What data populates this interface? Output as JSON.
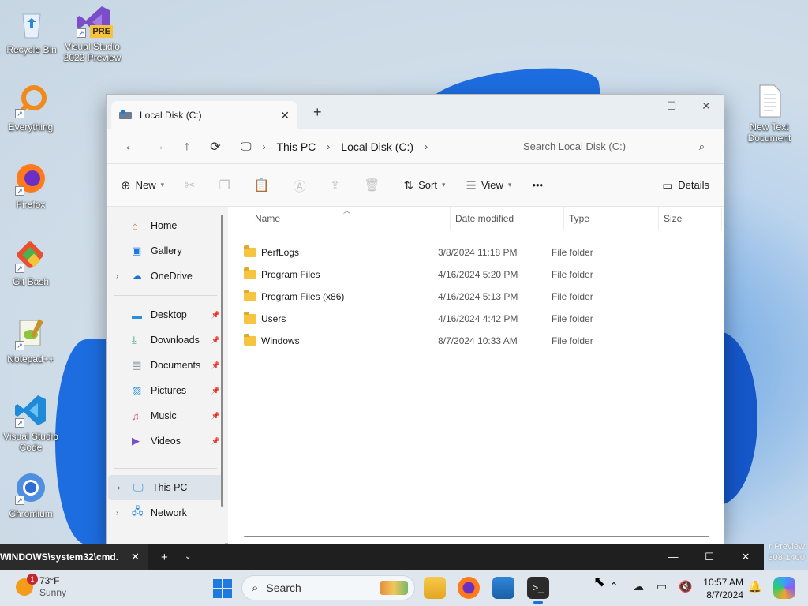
{
  "desktop": {
    "icons": [
      {
        "label": "Recycle Bin",
        "icon": "recycle-bin-icon"
      },
      {
        "label": "Visual Studio 2022 Preview",
        "icon": "visual-studio-icon",
        "badge": "PRE"
      },
      {
        "label": "Everything",
        "icon": "everything-search-icon"
      },
      {
        "label": "Firefox",
        "icon": "firefox-icon"
      },
      {
        "label": "Git Bash",
        "icon": "git-bash-icon"
      },
      {
        "label": "Notepad++",
        "icon": "notepad-plus-plus-icon"
      },
      {
        "label": "Visual Studio Code",
        "icon": "vscode-icon"
      },
      {
        "label": "Chromium",
        "icon": "chromium-icon"
      },
      {
        "label": "New Text Document",
        "icon": "text-document-icon"
      }
    ],
    "watermark_line1": "r Preview",
    "watermark_line2": "308-1400"
  },
  "explorer": {
    "tab_title": "Local Disk (C:)",
    "new_tab": "+",
    "breadcrumb": [
      "This PC",
      "Local Disk (C:)"
    ],
    "search_placeholder": "Search Local Disk (C:)",
    "toolbar": {
      "new_label": "New",
      "sort_label": "Sort",
      "view_label": "View",
      "more_label": "•••",
      "details_label": "Details"
    },
    "nav": {
      "top": [
        {
          "label": "Home",
          "icon": "home-icon"
        },
        {
          "label": "Gallery",
          "icon": "gallery-icon"
        },
        {
          "label": "OneDrive",
          "icon": "onedrive-icon",
          "expandable": true
        }
      ],
      "quick": [
        {
          "label": "Desktop",
          "icon": "desktop-folder-icon"
        },
        {
          "label": "Downloads",
          "icon": "downloads-icon"
        },
        {
          "label": "Documents",
          "icon": "documents-icon"
        },
        {
          "label": "Pictures",
          "icon": "pictures-icon"
        },
        {
          "label": "Music",
          "icon": "music-icon"
        },
        {
          "label": "Videos",
          "icon": "videos-icon"
        }
      ],
      "bottom": [
        {
          "label": "This PC",
          "icon": "this-pc-icon",
          "selected": true
        },
        {
          "label": "Network",
          "icon": "network-icon"
        }
      ]
    },
    "columns": {
      "name": "Name",
      "date": "Date modified",
      "type": "Type",
      "size": "Size"
    },
    "rows": [
      {
        "name": "PerfLogs",
        "date": "3/8/2024 11:18 PM",
        "type": "File folder"
      },
      {
        "name": "Program Files",
        "date": "4/16/2024 5:20 PM",
        "type": "File folder"
      },
      {
        "name": "Program Files (x86)",
        "date": "4/16/2024 5:13 PM",
        "type": "File folder"
      },
      {
        "name": "Users",
        "date": "4/16/2024 4:42 PM",
        "type": "File folder"
      },
      {
        "name": "Windows",
        "date": "8/7/2024 10:33 AM",
        "type": "File folder"
      }
    ]
  },
  "cmd": {
    "tab_title": "WINDOWS\\system32\\cmd.",
    "close": "✕",
    "plus": "+",
    "dropdown": "⌄"
  },
  "taskbar": {
    "weather_temp": "73°F",
    "weather_cond": "Sunny",
    "weather_badge": "1",
    "search_label": "Search",
    "time": "10:57 AM",
    "date": "8/7/2024"
  },
  "colors": {
    "accent": "#1f6fd8",
    "folder": "#f5c542",
    "taskbar_bg": "#dfe6ee",
    "cmd_bg": "#1f1f1f"
  }
}
